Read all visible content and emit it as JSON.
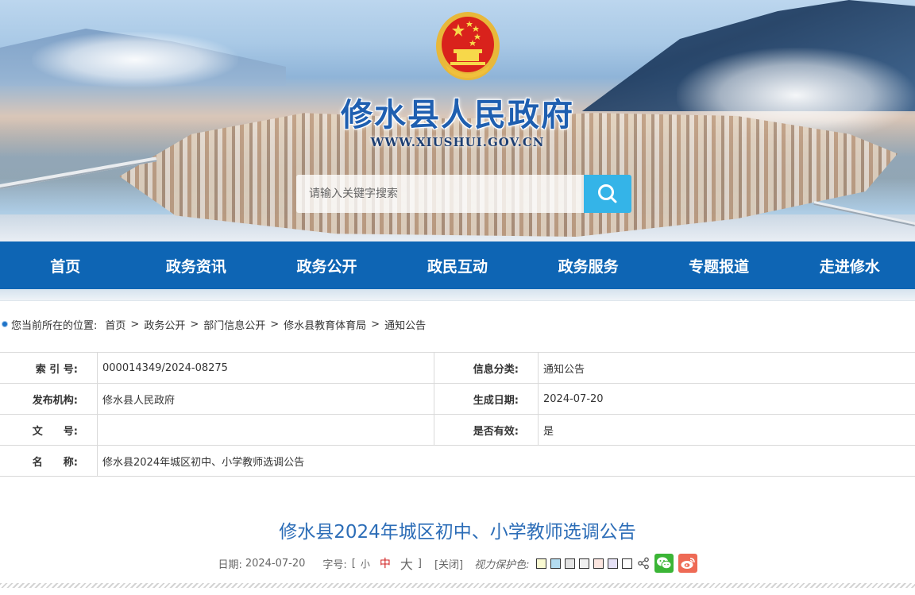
{
  "header": {
    "site_title": "修水县人民政府",
    "site_url": "WWW.XIUSHUI.GOV.CN",
    "search_placeholder": "请输入关键字搜索"
  },
  "nav": {
    "items": [
      {
        "label": "首页"
      },
      {
        "label": "政务资讯"
      },
      {
        "label": "政务公开"
      },
      {
        "label": "政民互动"
      },
      {
        "label": "政务服务"
      },
      {
        "label": "专题报道"
      },
      {
        "label": "走进修水"
      }
    ]
  },
  "breadcrumb": {
    "prefix": "您当前所在的位置:",
    "items": [
      "首页",
      "政务公开",
      "部门信息公开",
      "修水县教育体育局",
      "通知公告"
    ],
    "separator": ">"
  },
  "info_table": {
    "index_label": "索 引 号:",
    "index_value": "000014349/2024-08275",
    "category_label": "信息分类:",
    "category_value": "通知公告",
    "publisher_label": "发布机构:",
    "publisher_value": "修水县人民政府",
    "date_label": "生成日期:",
    "date_value": "2024-07-20",
    "doc_no_label": "文　　号:",
    "doc_no_value": "",
    "valid_label": "是否有效:",
    "valid_value": "是",
    "name_label": "名　　称:",
    "name_value": "修水县2024年城区初中、小学教师选调公告"
  },
  "article": {
    "title": "修水县2024年城区初中、小学教师选调公告",
    "date_label": "日期:",
    "date_value": "2024-07-20",
    "font_size_label": "字号:",
    "bracket_open": "[",
    "bracket_close": "]",
    "font_small": "小",
    "font_medium": "中",
    "font_large": "大",
    "close_label": "[关闭]",
    "eye_color_label": "视力保护色:",
    "eye_colors": [
      "#fafad2",
      "#b4dcf0",
      "#e3e3e3",
      "#f0f0f0",
      "#fde6e0",
      "#e5e0f5",
      "#ffffff"
    ]
  },
  "colors": {
    "nav_bg": "#0e65b4",
    "title_blue": "#2c6db7",
    "search_button": "#34b4e8",
    "wechat": "#3bb536",
    "weibo": "#ee6a55"
  }
}
